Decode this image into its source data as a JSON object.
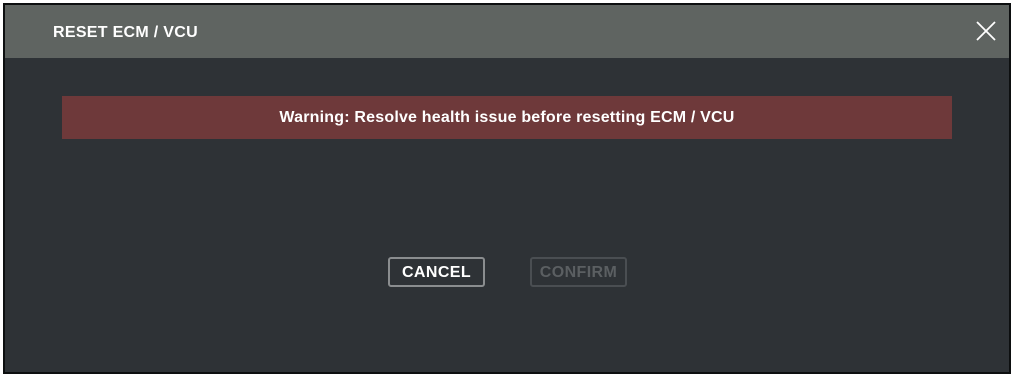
{
  "dialog": {
    "title": "RESET ECM / VCU",
    "close_icon": "close-icon",
    "warning_text": "Warning: Resolve health issue before resetting ECM / VCU",
    "buttons": {
      "cancel_label": "CANCEL",
      "confirm_label": "CONFIRM",
      "confirm_enabled": false
    }
  },
  "colors": {
    "titlebar": "#5f6461",
    "body_background": "#2e3236",
    "warning_background": "#6e393a",
    "text": "#ffffff",
    "disabled_text": "#5b5f62"
  }
}
